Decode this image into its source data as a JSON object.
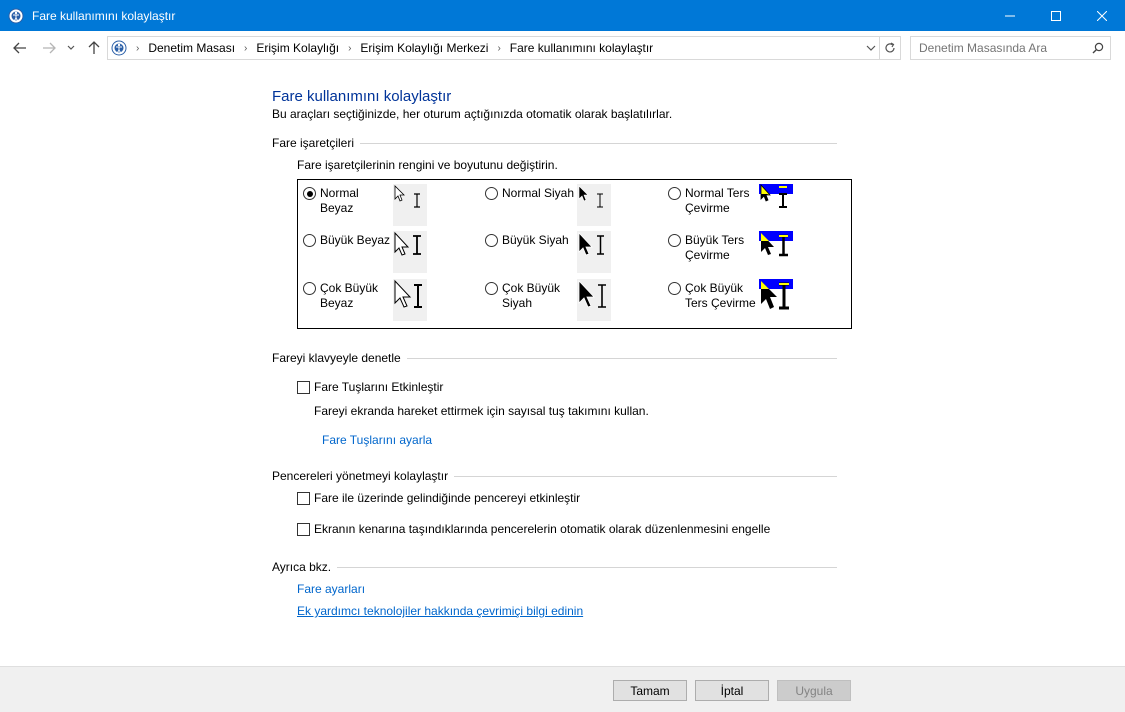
{
  "window": {
    "title": "Fare kullanımını kolaylaştır",
    "icon": "control-panel-icon"
  },
  "address_bar": {
    "breadcrumb": [
      "Denetim Masası",
      "Erişim Kolaylığı",
      "Erişim Kolaylığı Merkezi",
      "Fare kullanımını kolaylaştır"
    ],
    "search_placeholder": "Denetim Masasında Ara"
  },
  "page": {
    "title": "Fare kullanımını kolaylaştır",
    "subtitle": "Bu araçları seçtiğinizde, her oturum açtığınızda otomatik olarak başlatılırlar."
  },
  "pointers": {
    "heading": "Fare işaretçileri",
    "description": "Fare işaretçilerinin rengini ve boyutunu değiştirin.",
    "options": [
      {
        "line1": "Normal",
        "line2": "Beyaz",
        "selected": true
      },
      {
        "line1": "Normal Siyah",
        "line2": "",
        "selected": false
      },
      {
        "line1": "Normal Ters",
        "line2": "Çevirme",
        "selected": false
      },
      {
        "line1": "Büyük Beyaz",
        "line2": "",
        "selected": false
      },
      {
        "line1": "Büyük Siyah",
        "line2": "",
        "selected": false
      },
      {
        "line1": "Büyük Ters",
        "line2": "Çevirme",
        "selected": false
      },
      {
        "line1": "Çok Büyük",
        "line2": "Beyaz",
        "selected": false
      },
      {
        "line1": "Çok Büyük",
        "line2": "Siyah",
        "selected": false
      },
      {
        "line1": "Çok Büyük",
        "line2": "Ters Çevirme",
        "selected": false
      }
    ]
  },
  "keyboard": {
    "heading": "Fareyi klavyeyle denetle",
    "mouse_keys_label": "Fare Tuşlarını Etkinleştir",
    "mouse_keys_checked": false,
    "mouse_keys_desc": "Fareyi ekranda hareket ettirmek için sayısal tuş takımını kullan.",
    "mouse_keys_link": "Fare Tuşlarını ayarla"
  },
  "windows": {
    "heading": "Pencereleri yönetmeyi kolaylaştır",
    "hover_activate_label": "Fare ile üzerinde gelindiğinde pencereyi etkinleştir",
    "hover_activate_checked": false,
    "snap_label": "Ekranın kenarına taşındıklarında pencerelerin otomatik olarak düzenlenmesini engelle",
    "snap_checked": false
  },
  "see_also": {
    "heading": "Ayrıca bkz.",
    "link1": "Fare ayarları",
    "link2": "Ek yardımcı teknolojiler hakkında çevrimiçi bilgi edinin"
  },
  "buttons": {
    "ok": "Tamam",
    "cancel": "İptal",
    "apply": "Uygula"
  },
  "colors": {
    "titlebar": "#0078d7",
    "heading": "#003399",
    "link": "#0066cc",
    "inverted_bg": "#0000ff",
    "inverted_fg": "#ffff00"
  }
}
